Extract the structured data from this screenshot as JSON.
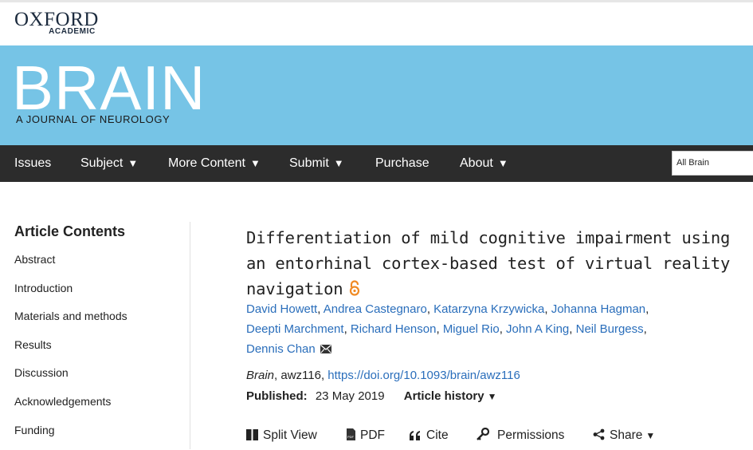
{
  "header": {
    "publisher_name": "OXFORD",
    "publisher_sub": "ACADEMIC",
    "journal_title": "BRAIN",
    "journal_subtitle": "A JOURNAL OF NEUROLOGY"
  },
  "nav": {
    "items": [
      {
        "label": "Issues",
        "has_dropdown": false
      },
      {
        "label": "Subject",
        "has_dropdown": true
      },
      {
        "label": "More Content",
        "has_dropdown": true
      },
      {
        "label": "Submit",
        "has_dropdown": true
      },
      {
        "label": "Purchase",
        "has_dropdown": false
      },
      {
        "label": "About",
        "has_dropdown": true
      }
    ],
    "search_scope": "All Brain"
  },
  "sidebar": {
    "title": "Article Contents",
    "items": [
      {
        "label": "Abstract"
      },
      {
        "label": "Introduction"
      },
      {
        "label": "Materials and methods"
      },
      {
        "label": "Results"
      },
      {
        "label": "Discussion"
      },
      {
        "label": "Acknowledgements"
      },
      {
        "label": "Funding"
      }
    ]
  },
  "article": {
    "title": "Differentiation of mild cognitive impairment using an entorhinal cortex-based test of virtual reality navigation",
    "authors": [
      "David Howett",
      "Andrea Castegnaro",
      "Katarzyna Krzywicka",
      "Johanna Hagman",
      "Deepti Marchment",
      "Richard Henson",
      "Miguel Rio",
      "John A King",
      "Neil Burgess",
      "Dennis Chan"
    ],
    "journal": "Brain",
    "article_id": ", awz116, ",
    "doi": "https://doi.org/10.1093/brain/awz116",
    "published_label": "Published:",
    "published_date": "23 May 2019",
    "history_label": "Article history"
  },
  "toolbar": {
    "split_view": "Split View",
    "pdf": "PDF",
    "cite": "Cite",
    "permissions": "Permissions",
    "share": "Share"
  },
  "colors": {
    "banner": "#76c4e6",
    "nav": "#2c2c2c",
    "link": "#2a6ebb",
    "open_access": "#f08a24"
  }
}
